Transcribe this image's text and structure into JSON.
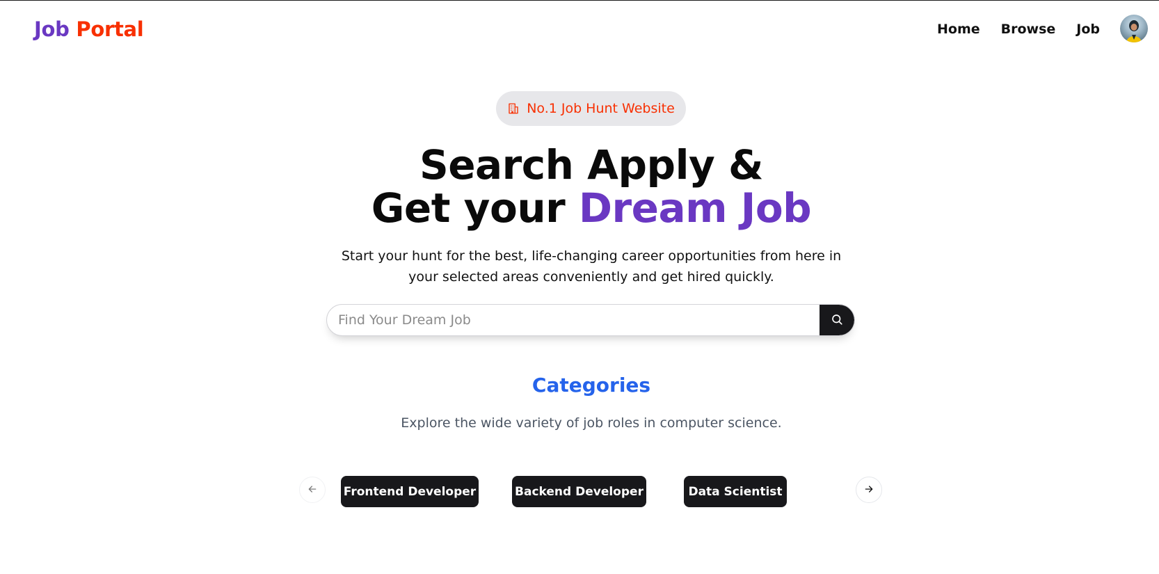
{
  "navbar": {
    "logo_part1": "Job",
    "logo_part2": "Portal",
    "links": [
      {
        "label": "Home"
      },
      {
        "label": "Browse"
      },
      {
        "label": "Job"
      }
    ],
    "avatar_icon": "user-avatar"
  },
  "hero": {
    "badge_icon": "building-icon",
    "badge_text": "No.1 Job Hunt Website",
    "headline_line1": "Search Apply &",
    "headline_line2_prefix": "Get your ",
    "headline_line2_accent": "Dream Job",
    "subtext": "Start your hunt for the best, life-changing career opportunities from here in your selected areas conveniently and get hired quickly."
  },
  "search": {
    "placeholder": "Find Your Dream Job",
    "value": "",
    "button_icon": "search-icon"
  },
  "categories": {
    "title": "Categories",
    "subtitle": "Explore the wide variety of job roles in computer science.",
    "items": [
      {
        "label": "Frontend Developer"
      },
      {
        "label": "Backend Developer"
      },
      {
        "label": "Data Scientist"
      }
    ],
    "prev_icon": "arrow-left-icon",
    "next_icon": "arrow-right-icon"
  },
  "colors": {
    "brand_purple": "#6a38c2",
    "brand_orange": "#f83002",
    "categories_blue": "#2563eb",
    "dark": "#18181b"
  }
}
